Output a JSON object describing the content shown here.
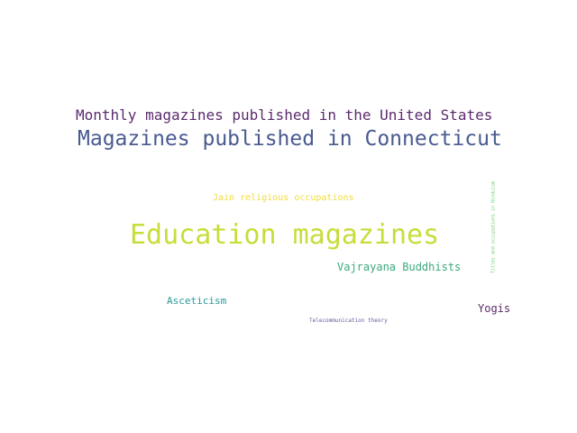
{
  "words": [
    {
      "id": "w0",
      "text": "Monthly magazines published in the United States",
      "color": "#5b2a6e"
    },
    {
      "id": "w1",
      "text": "Magazines published in Connecticut",
      "color": "#4a5a90"
    },
    {
      "id": "w2",
      "text": "Jain religious occupations",
      "color": "#f2dc3a"
    },
    {
      "id": "w3",
      "text": "Education magazines",
      "color": "#c8dc3a"
    },
    {
      "id": "w4",
      "text": "Vajrayana Buddhists",
      "color": "#3aaa7c"
    },
    {
      "id": "w5",
      "text": "Asceticism",
      "color": "#2a9a9a"
    },
    {
      "id": "w6",
      "text": "Yogis",
      "color": "#5a2a6a"
    },
    {
      "id": "w7",
      "text": "Telecommunication theory",
      "color": "#6a5aa0"
    },
    {
      "id": "w8",
      "text": "Titles and occupations in Hinduism",
      "color": "#6aca6a"
    }
  ]
}
